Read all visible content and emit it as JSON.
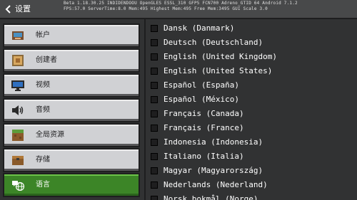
{
  "header": {
    "back_icon": "back-arrow-icon",
    "title": "设置",
    "debug_line1": "Beta 1.18.30.25 INDIDENDOOU OpenGLES ESSL_310 GFP5 FCN700 Adreno_GTID 64 Android 7.1.2",
    "debug_line2": "FPS:57.0 ServerTime:8.0 Mem:495 Highest Mem:495 Free Mem:3495 GUI Scale 3.0"
  },
  "sidebar": {
    "items": [
      {
        "label": "帐户",
        "icon": "account-icon",
        "active": false
      },
      {
        "label": "创建者",
        "icon": "creator-icon",
        "active": false
      },
      {
        "label": "视频",
        "icon": "monitor-icon",
        "active": false
      },
      {
        "label": "音频",
        "icon": "speaker-icon",
        "active": false
      },
      {
        "label": "全局资源",
        "icon": "global-resources-icon",
        "active": false
      },
      {
        "label": "存储",
        "icon": "storage-icon",
        "active": false
      },
      {
        "label": "语言",
        "icon": "language-icon",
        "active": true
      }
    ]
  },
  "languages": {
    "items": [
      "Dansk (Danmark)",
      "Deutsch (Deutschland)",
      "English (United Kingdom)",
      "English (United States)",
      "Español (España)",
      "Español (México)",
      "Français (Canada)",
      "Français (France)",
      "Indonesia (Indonesia)",
      "Italiano (Italia)",
      "Magyar (Magyarország)",
      "Nederlands (Nederland)",
      "Norsk bokmål (Norge)"
    ]
  },
  "colors": {
    "background": "#313233",
    "header": "#48494a",
    "sidebar_item": "#d0d1d4",
    "active_item": "#3c8527"
  }
}
